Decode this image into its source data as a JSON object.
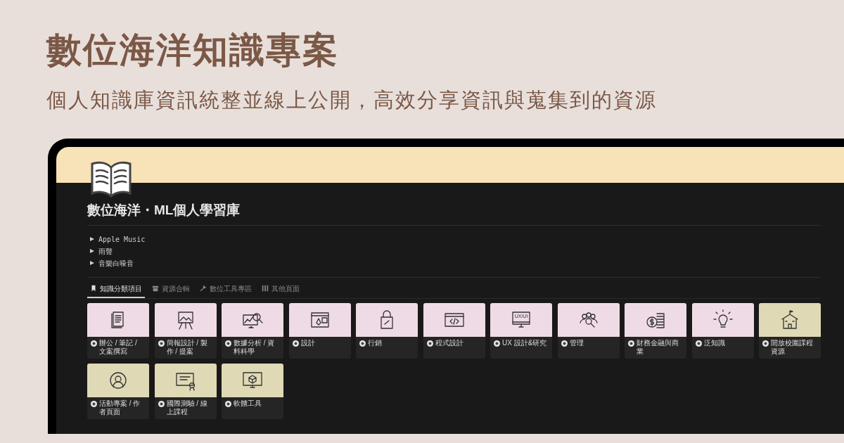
{
  "headline": "數位海洋知識專案",
  "subheadline": "個人知識庫資訊統整並線上公開，高效分享資訊與蒐集到的資源",
  "page": {
    "title": "數位海洋・ML個人學習庫",
    "toggles": [
      {
        "label": "Apple Music",
        "expanded": false
      },
      {
        "label": "雨聲",
        "expanded": false
      },
      {
        "label": "音樂白噪音",
        "expanded": false
      }
    ],
    "tabs": [
      {
        "label": "知識分類項目",
        "selected": true
      },
      {
        "label": "資源合輯",
        "selected": false
      },
      {
        "label": "數位工具專區",
        "selected": false
      },
      {
        "label": "其他頁面",
        "selected": false
      }
    ],
    "cards": [
      {
        "label": "辦公 / 筆記 / 文案撰寫",
        "color": "#efdbe6"
      },
      {
        "label": "簡報設計 / 製作 / 提案",
        "color": "#efdbe6"
      },
      {
        "label": "數據分析 / 資料科學",
        "color": "#efdbe6"
      },
      {
        "label": "設計",
        "color": "#efdbe6"
      },
      {
        "label": "行銷",
        "color": "#efdbe6"
      },
      {
        "label": "程式設計",
        "color": "#efdbe6"
      },
      {
        "label": "UX  設計&研究",
        "color": "#efdbe6",
        "icon_text": "UX/UI"
      },
      {
        "label": "管理",
        "color": "#efdbe6"
      },
      {
        "label": "財務金融與商業",
        "color": "#efdbe6"
      },
      {
        "label": "泛知識",
        "color": "#efdbe6"
      },
      {
        "label": "開放校園課程資源",
        "color": "#dfd9b5"
      },
      {
        "label": "活動專案 / 作者頁面",
        "color": "#dfd9b5"
      },
      {
        "label": "國際測驗 / 線上課程",
        "color": "#dfd9b5"
      },
      {
        "label": "軟體工具",
        "color": "#dfd9b5"
      }
    ]
  }
}
